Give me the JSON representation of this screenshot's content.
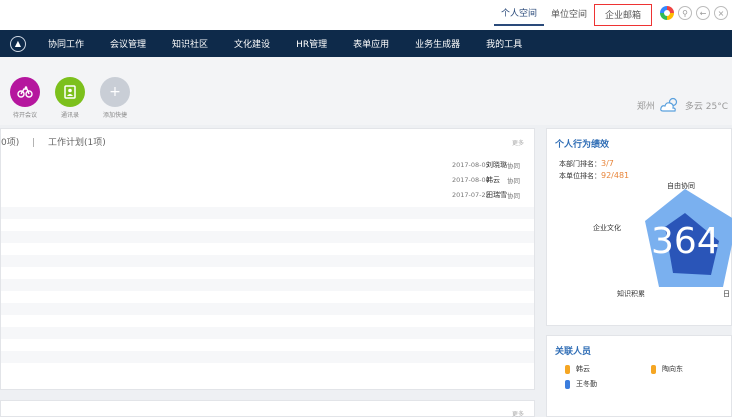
{
  "topbar": {
    "links": [
      "个人空间",
      "单位空间",
      "企业邮箱"
    ]
  },
  "nav": {
    "items": [
      "协同工作",
      "会议管理",
      "知识社区",
      "文化建设",
      "HR管理",
      "表单应用",
      "业务生成器",
      "我的工具"
    ]
  },
  "quick": {
    "items": [
      {
        "label": "待开会议",
        "icon": "meeting-bike-icon",
        "color": "#b5169e"
      },
      {
        "label": "通讯录",
        "icon": "address-book-icon",
        "color": "#7cc01c"
      },
      {
        "label": "添加快捷",
        "icon": "plus-icon",
        "color": "#c9ced6"
      }
    ],
    "add_symbol": "+",
    "weather_city": "郑州",
    "weather_text": "多云 25°C"
  },
  "main": {
    "tab_partial": "0项)",
    "tab_sep": "|",
    "tab_plan": "工作计划(1项)",
    "more": "更多",
    "rows": [
      {
        "date": "2017-08-05",
        "person": "刘晓璐",
        "type": "协同"
      },
      {
        "date": "2017-08-04",
        "person": "韩云",
        "type": "协同"
      },
      {
        "date": "2017-07-22",
        "person": "田瑞雪",
        "type": "协同"
      }
    ]
  },
  "card2": {
    "more": "更多"
  },
  "perf": {
    "title": "个人行为绩效",
    "dept_rank_label": "本部门排名：",
    "dept_rank": "3/7",
    "unit_rank_label": "本单位排名：",
    "unit_rank": "92/481",
    "score": "364",
    "axes": [
      "自由协同",
      "企业文化",
      "知识积累",
      "日"
    ]
  },
  "related": {
    "title": "关联人员",
    "people": [
      {
        "name": "韩云",
        "color": "#f5a623"
      },
      {
        "name": "陶向东",
        "color": "#f5a623"
      },
      {
        "name": "王冬勤",
        "color": "#3b7ddd"
      }
    ]
  },
  "colors": {
    "nav_bg": "#0e2a4a",
    "accent": "#2f6db5",
    "rank": "#e8853a",
    "radar_outer": "#7ab0ef",
    "radar_inner": "#2a55b8"
  }
}
